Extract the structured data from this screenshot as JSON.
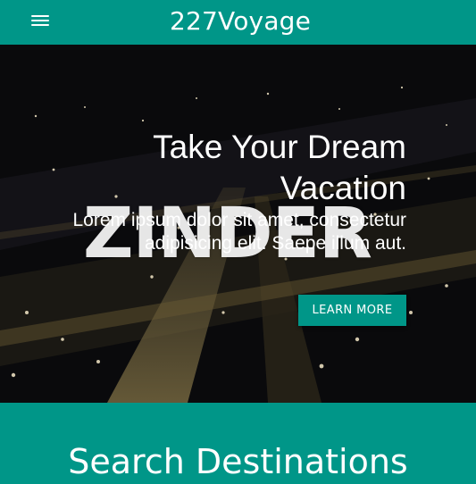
{
  "header": {
    "menu_icon": "hamburger-menu-icon",
    "brand": "227Voyage"
  },
  "hero": {
    "title": "Take Your Dream Vacation",
    "overlay_word": "ZINDER",
    "subtitle": "Lorem ipsum dolor sit amet, consectetur adipisicing elit. Saepe illum aut.",
    "button_label": "LEARN MORE"
  },
  "search": {
    "title": "Search Destinations"
  },
  "colors": {
    "accent": "#009688",
    "hero_background": "#0d0d0d",
    "text": "#ffffff"
  }
}
